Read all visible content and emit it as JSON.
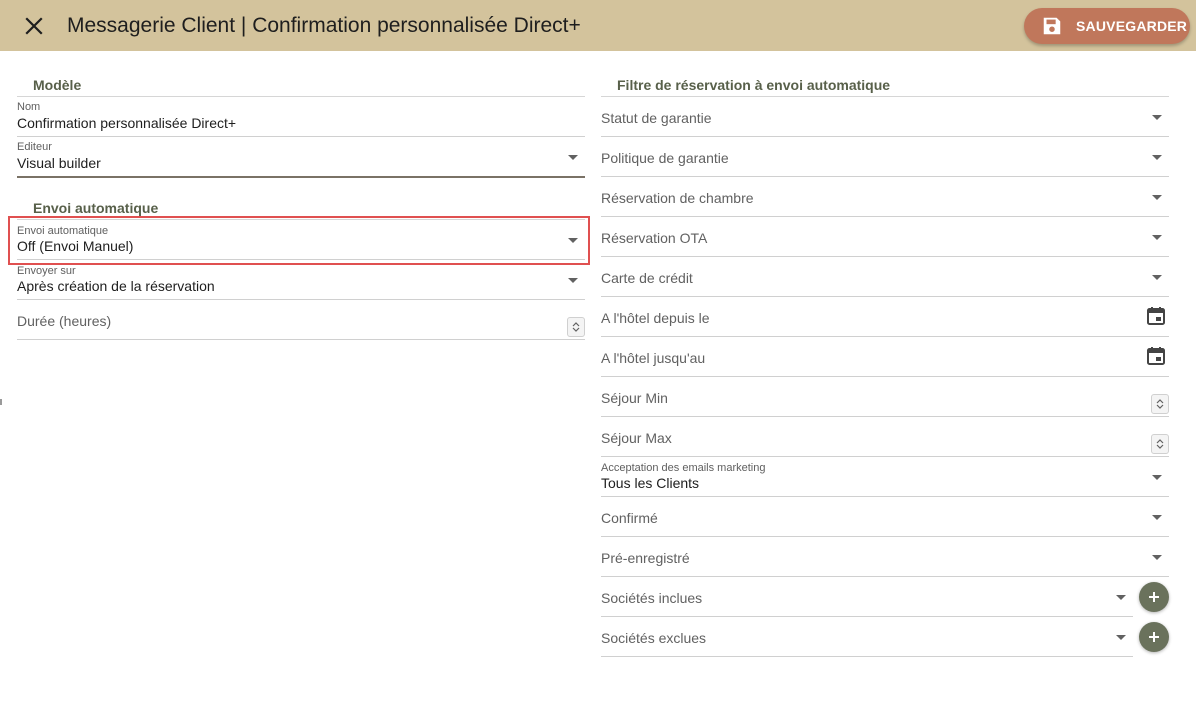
{
  "header": {
    "title": "Messagerie Client | Confirmation personnalisée Direct+",
    "save_label": "SAUVEGARDER",
    "close_icon": "close-icon",
    "save_icon": "floppy-disk-icon",
    "bar_color": "#d3c39c",
    "save_color": "#c0775b"
  },
  "left": {
    "section_model": "Modèle",
    "nom_label": "Nom",
    "nom_value": "Confirmation personnalisée Direct+",
    "editeur_label": "Editeur",
    "editeur_value": "Visual builder",
    "section_auto": "Envoi automatique",
    "envoi_label": "Envoi automatique",
    "envoi_value": "Off (Envoi Manuel)",
    "envoyer_label": "Envoyer sur",
    "envoyer_value": "Après création de la réservation",
    "duree_placeholder": "Durée (heures)"
  },
  "right": {
    "section_title": "Filtre de réservation à envoi automatique",
    "statut_garantie": "Statut de garantie",
    "politique_garantie": "Politique de garantie",
    "reservation_chambre": "Réservation de chambre",
    "reservation_ota": "Réservation OTA",
    "carte_credit": "Carte de crédit",
    "hotel_depuis": "A l'hôtel depuis le",
    "hotel_jusqu": "A l'hôtel jusqu'au",
    "sejour_min": "Séjour Min",
    "sejour_max": "Séjour Max",
    "acceptation_label": "Acceptation des emails marketing",
    "acceptation_value": "Tous les Clients",
    "confirme": "Confirmé",
    "pre_enregistre": "Pré-enregistré",
    "societes_incluses": "Sociétés inclues",
    "societes_exclues": "Sociétés exclues"
  }
}
